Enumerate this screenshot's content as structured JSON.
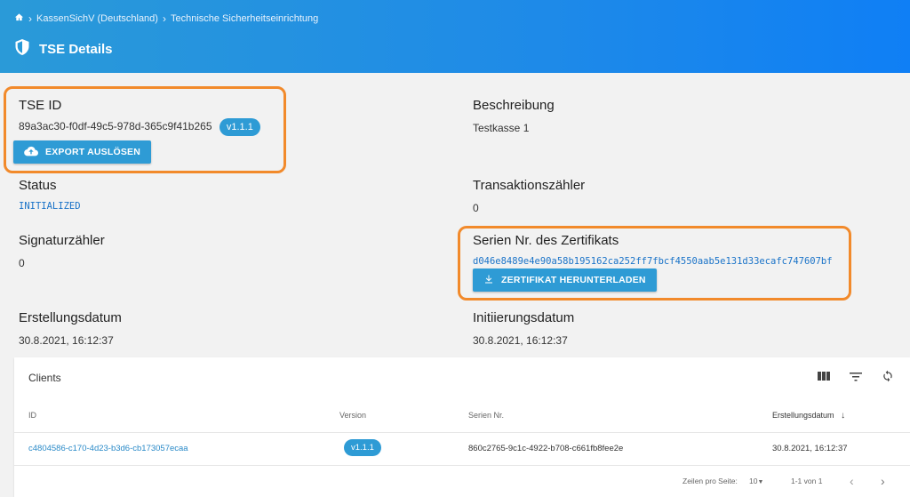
{
  "header": {
    "breadcrumb": [
      "KassenSichV (Deutschland)",
      "Technische Sicherheitseinrichtung"
    ],
    "title": "TSE Details"
  },
  "tse": {
    "id_label": "TSE ID",
    "id_value": "89a3ac30-f0df-49c5-978d-365c9f41b265",
    "version": "v1.1.1",
    "export_button": "EXPORT AUSLÖSEN",
    "description_label": "Beschreibung",
    "description_value": "Testkasse 1",
    "status_label": "Status",
    "status_value": "INITIALIZED",
    "tx_counter_label": "Transaktionszähler",
    "tx_counter_value": "0",
    "sig_counter_label": "Signaturzähler",
    "sig_counter_value": "0",
    "cert_serial_label": "Serien Nr. des Zertifikats",
    "cert_serial_value": "d046e8489e4e90a58b195162ca252ff7fbcf4550aab5e131d33ecafc747607bf",
    "cert_button": "ZERTIFIKAT HERUNTERLADEN",
    "created_label": "Erstellungsdatum",
    "created_value": "30.8.2021, 16:12:37",
    "init_label": "Initiierungsdatum",
    "init_value": "30.8.2021, 16:12:37"
  },
  "clients": {
    "title": "Clients",
    "columns": [
      "ID",
      "Version",
      "Serien Nr.",
      "Erstellungsdatum"
    ],
    "rows": [
      {
        "id": "c4804586-c170-4d23-b3d6-cb173057ecaa",
        "version": "v1.1.1",
        "serial": "860c2765-9c1c-4922-b708-c661fb8fee2e",
        "created": "30.8.2021, 16:12:37"
      }
    ],
    "footer": {
      "rows_per_page_label": "Zeilen pro Seite:",
      "rows_per_page_value": "10",
      "range": "1-1 von 1"
    }
  },
  "colors": {
    "accent": "#2e9bd5",
    "highlight": "#f28a2b",
    "header_start": "#2a9ad8",
    "header_end": "#0f7ff5"
  }
}
